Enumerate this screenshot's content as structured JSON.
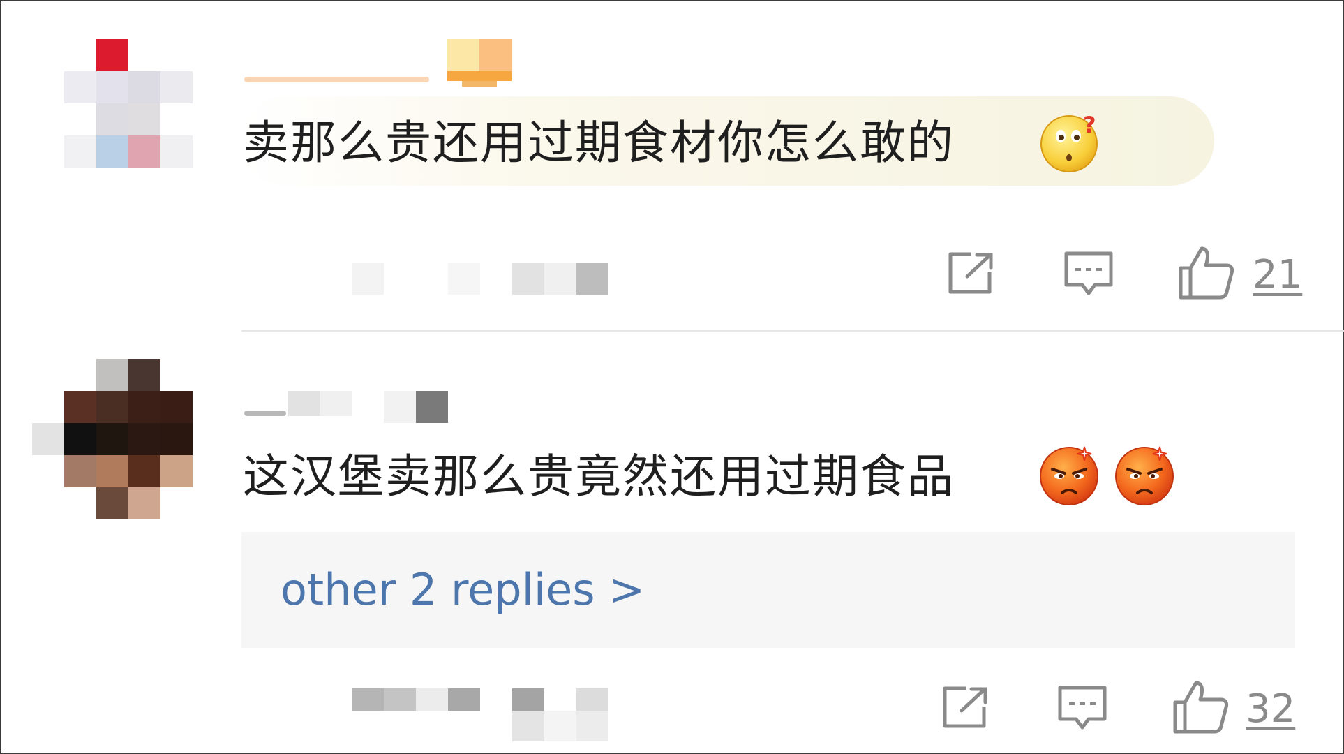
{
  "comments": [
    {
      "text": "卖那么贵还用过期食材你怎么敢的",
      "emoji": "confused-face-emoji",
      "like_count": "21"
    },
    {
      "text": "这汉堡卖那么贵竟然还用过期食品",
      "emoji": "angry-face-emoji",
      "like_count": "32",
      "replies_link": "other 2 replies >"
    }
  ],
  "colors": {
    "link": "#4d77ac",
    "divider": "#e6e6e6",
    "icon_gray": "#8a8a8a",
    "reply_bg": "#f6f6f6"
  }
}
